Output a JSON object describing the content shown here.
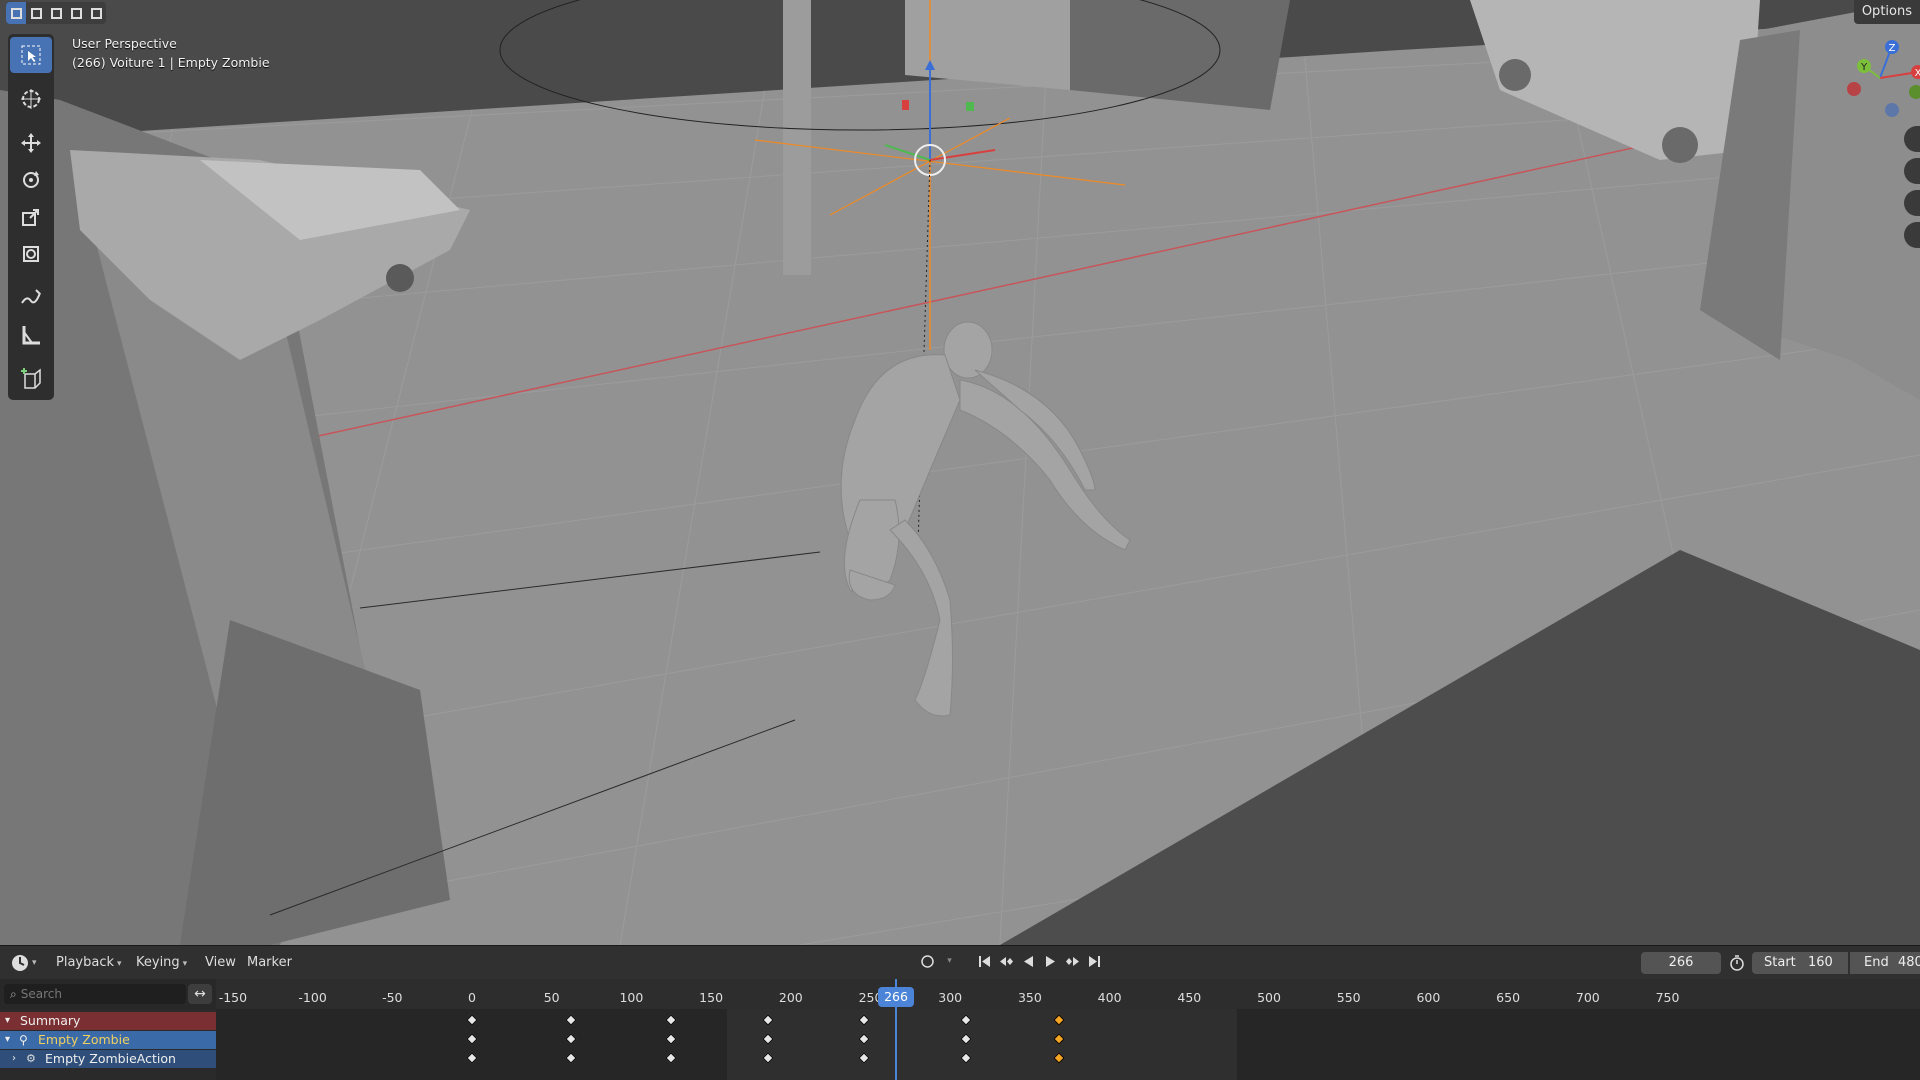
{
  "viewport": {
    "perspective": "User Perspective",
    "object_info": "(266) Voiture 1 | Empty Zombie",
    "options_label": "Options",
    "gizmo_axes": {
      "x": "X",
      "y": "Y",
      "z": "Z"
    }
  },
  "header_modes": [
    "select-box",
    "extend",
    "subtract",
    "difference",
    "intersect"
  ],
  "toolbar": {
    "tools": [
      {
        "name": "select-box",
        "icon": "select-box-icon",
        "active": true
      },
      {
        "name": "cursor",
        "icon": "cursor-icon"
      },
      {
        "name": "move",
        "icon": "move-icon"
      },
      {
        "name": "rotate",
        "icon": "rotate-icon"
      },
      {
        "name": "scale",
        "icon": "scale-icon"
      },
      {
        "name": "transform",
        "icon": "transform-icon"
      },
      {
        "name": "annotate",
        "icon": "annotate-icon"
      },
      {
        "name": "measure",
        "icon": "measure-icon"
      },
      {
        "name": "add-cube",
        "icon": "add-cube-icon"
      }
    ]
  },
  "timeline": {
    "menus": {
      "playback": "Playback",
      "keying": "Keying",
      "view": "View",
      "marker": "Marker"
    },
    "current_frame": "266",
    "start_label": "Start",
    "start_value": "160",
    "end_label": "End",
    "end_value": "480",
    "search_placeholder": "Search",
    "ruler_ticks": [
      "-150",
      "-100",
      "-50",
      "0",
      "50",
      "100",
      "150",
      "200",
      "250",
      "300",
      "350",
      "400",
      "450",
      "500",
      "550",
      "600",
      "650",
      "700",
      "750"
    ],
    "channels": [
      "Summary",
      "Empty Zombie",
      "Empty ZombieAction"
    ],
    "keyframes": [
      {
        "frame": 0,
        "selected": false
      },
      {
        "frame": 62,
        "selected": false
      },
      {
        "frame": 125,
        "selected": false
      },
      {
        "frame": 186,
        "selected": false
      },
      {
        "frame": 246,
        "selected": false
      },
      {
        "frame": 310,
        "selected": false
      },
      {
        "frame": 368,
        "selected": true
      }
    ]
  },
  "colors": {
    "accent": "#4772b3",
    "playhead": "#4c85d8",
    "summary_row": "#7a2f33",
    "object_row": "#3b6aa8",
    "selected_key": "#f5a623"
  }
}
